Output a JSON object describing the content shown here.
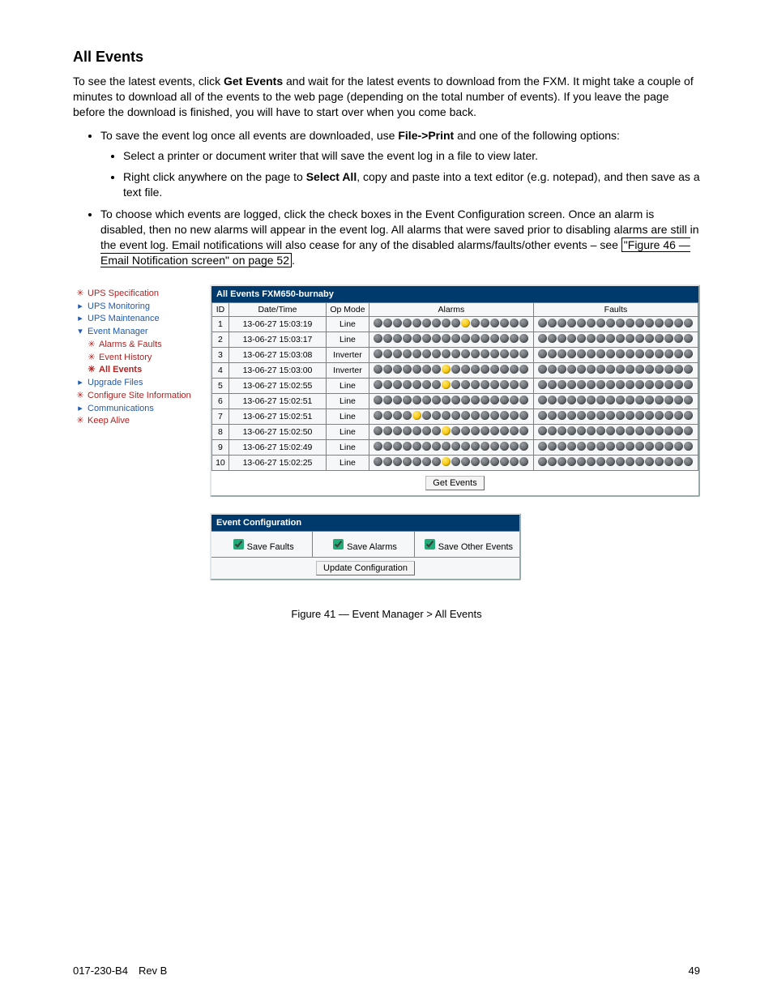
{
  "section_title": "All Events",
  "intro_part1": "To see the latest events, click ",
  "intro_bold1": "Get Events",
  "intro_part2": " and wait for the latest events to download from the FXM. It might take a couple of minutes to download all of the events to the web page (depending on the total number of events). If you leave the page before the download is finished, you will have to start over when you come back.",
  "b1_part1": "To save the event log once all events are downloaded, use ",
  "b1_bold": "File->Print",
  "b1_part2": " and one of the following options:",
  "b1a": "Select a printer or document writer that will save the event log in a file to view later.",
  "b1b_part1": "Right click anywhere on the page to ",
  "b1b_bold": "Select All",
  "b1b_part2": ", copy and paste into a text editor (e.g. notepad), and then save as a text file.",
  "b2_part1": "To choose which events are logged, click the check boxes in the Event Configuration screen. Once an alarm is disabled, then no new alarms will appear in the event log. All alarms that were saved prior to disabling alarms are still in the event log. Email notifications will also cease for any of the disabled alarms/faults/other events – see ",
  "b2_ref": "\"Figure 46  — Email Notification screen\" on page 52",
  "b2_part2": ".",
  "nav": {
    "items": [
      {
        "label": "UPS Specification",
        "cls": "nav-red",
        "glyph": "✳",
        "indent": false
      },
      {
        "label": "UPS Monitoring",
        "cls": "nav-blue",
        "glyph": "▸",
        "indent": false
      },
      {
        "label": "UPS Maintenance",
        "cls": "nav-blue",
        "glyph": "▸",
        "indent": false
      },
      {
        "label": "Event Manager",
        "cls": "nav-blue",
        "glyph": "▾",
        "indent": false
      },
      {
        "label": "Alarms & Faults",
        "cls": "nav-red",
        "glyph": "✳",
        "indent": true
      },
      {
        "label": "Event History",
        "cls": "nav-red",
        "glyph": "✳",
        "indent": true
      },
      {
        "label": "All Events",
        "cls": "nav-red nav-bold",
        "glyph": "✳",
        "indent": true
      },
      {
        "label": "Upgrade Files",
        "cls": "nav-blue",
        "glyph": "▸",
        "indent": false
      },
      {
        "label": "Configure Site Information",
        "cls": "nav-red",
        "glyph": "✳",
        "indent": false
      },
      {
        "label": "Communications",
        "cls": "nav-blue",
        "glyph": "▸",
        "indent": false
      },
      {
        "label": "Keep Alive",
        "cls": "nav-red",
        "glyph": "✳",
        "indent": false
      }
    ]
  },
  "events_panel_title": "All Events FXM650-burnaby",
  "table": {
    "headers": {
      "id": "ID",
      "dt": "Date/Time",
      "op": "Op Mode",
      "alarms": "Alarms",
      "faults": "Faults"
    },
    "dot_count": 16,
    "rows": [
      {
        "id": "1",
        "dt": "13-06-27 15:03:19",
        "op": "Line",
        "alarm_on": [
          9
        ],
        "fault_on": []
      },
      {
        "id": "2",
        "dt": "13-06-27 15:03:17",
        "op": "Line",
        "alarm_on": [],
        "fault_on": []
      },
      {
        "id": "3",
        "dt": "13-06-27 15:03:08",
        "op": "Inverter",
        "alarm_on": [],
        "fault_on": []
      },
      {
        "id": "4",
        "dt": "13-06-27 15:03:00",
        "op": "Inverter",
        "alarm_on": [
          7
        ],
        "fault_on": []
      },
      {
        "id": "5",
        "dt": "13-06-27 15:02:55",
        "op": "Line",
        "alarm_on": [
          7
        ],
        "fault_on": []
      },
      {
        "id": "6",
        "dt": "13-06-27 15:02:51",
        "op": "Line",
        "alarm_on": [],
        "fault_on": []
      },
      {
        "id": "7",
        "dt": "13-06-27 15:02:51",
        "op": "Line",
        "alarm_on": [
          4
        ],
        "fault_on": []
      },
      {
        "id": "8",
        "dt": "13-06-27 15:02:50",
        "op": "Line",
        "alarm_on": [
          7
        ],
        "fault_on": []
      },
      {
        "id": "9",
        "dt": "13-06-27 15:02:49",
        "op": "Line",
        "alarm_on": [],
        "fault_on": []
      },
      {
        "id": "10",
        "dt": "13-06-27 15:02:25",
        "op": "Line",
        "alarm_on": [
          7
        ],
        "fault_on": []
      }
    ]
  },
  "get_events_btn": "Get Events",
  "cfg_panel_title": "Event Configuration",
  "cfg": {
    "save_faults": "Save Faults",
    "save_alarms": "Save Alarms",
    "save_other": "Save Other Events",
    "update_btn": "Update Configuration"
  },
  "figure_caption": "Figure 41  —  Event Manager > All Events",
  "footer_left": "017-230-B4 Rev B",
  "footer_right": "49"
}
